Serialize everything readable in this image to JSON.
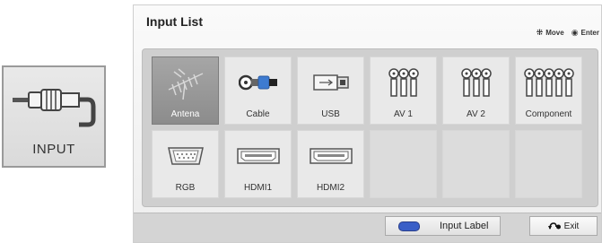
{
  "remote_key": {
    "label": "INPUT",
    "icon": "rca-plug-icon"
  },
  "dialog": {
    "title": "Input List",
    "hints": {
      "move_label": "Move",
      "enter_label": "Enter"
    }
  },
  "inputs": [
    {
      "label": "Antena",
      "icon": "antenna-icon",
      "selected": true
    },
    {
      "label": "Cable",
      "icon": "coax-cable-icon"
    },
    {
      "label": "USB",
      "icon": "usb-icon"
    },
    {
      "label": "AV 1",
      "icon": "rca-jacks-3-icon"
    },
    {
      "label": "AV 2",
      "icon": "rca-jacks-3-icon"
    },
    {
      "label": "Component",
      "icon": "rca-jacks-5-icon"
    },
    {
      "label": "RGB",
      "icon": "vga-port-icon"
    },
    {
      "label": "HDMI1",
      "icon": "hdmi-port-icon"
    },
    {
      "label": "HDMI2",
      "icon": "hdmi-port-icon"
    }
  ],
  "footer": {
    "input_label": "Input Label",
    "input_label_key_color": "#3a5fc7",
    "exit_label": "Exit"
  }
}
